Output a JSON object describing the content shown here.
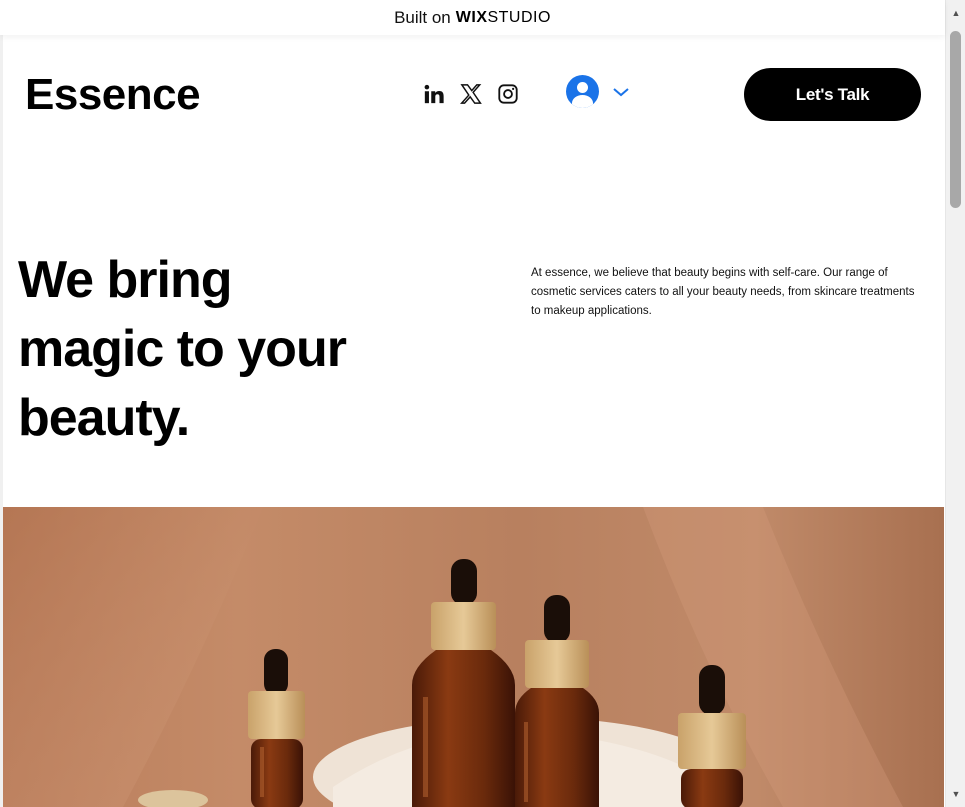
{
  "banner": {
    "built_on": "Built on",
    "wix": "WIX",
    "studio": "STUDIO"
  },
  "header": {
    "logo": "Essence",
    "socials": [
      "linkedin-icon",
      "x-icon",
      "instagram-icon"
    ],
    "cta_label": "Let's Talk"
  },
  "hero": {
    "headline_lines": [
      "We bring",
      "magic to your",
      "beauty."
    ],
    "blurb": "At essence, we believe that beauty begins with self-care. Our range of cosmetic services caters to all your beauty needs, from skincare treatments to makeup applications."
  },
  "colors": {
    "accent": "#1a73e8",
    "cta_bg": "#000000",
    "image_bg": "#c08a69"
  }
}
